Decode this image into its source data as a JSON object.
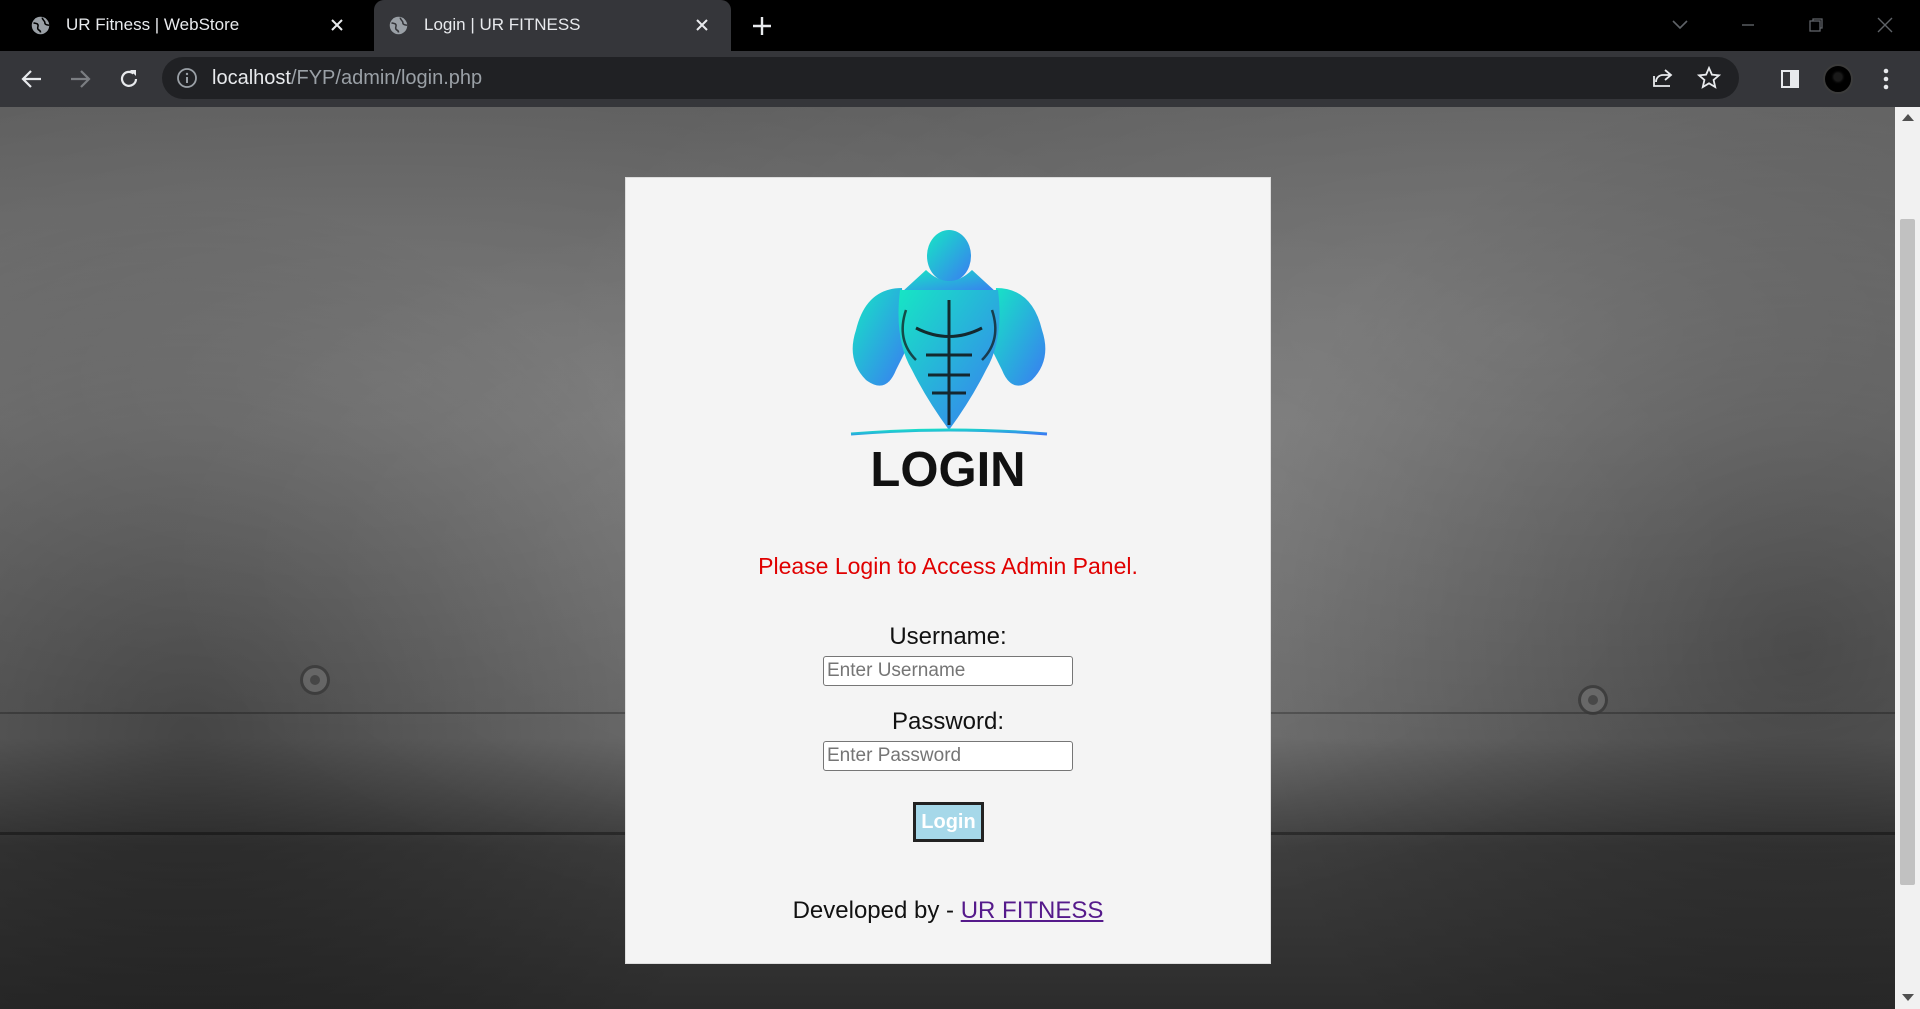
{
  "browser": {
    "tabs": [
      {
        "title": "UR Fitness | WebStore",
        "active": false
      },
      {
        "title": "Login | UR FITNESS",
        "active": true
      }
    ],
    "url": {
      "host": "localhost",
      "path": "/FYP/admin/login.php"
    }
  },
  "login": {
    "heading": "LOGIN",
    "notice": "Please Login to Access Admin Panel.",
    "username_label": "Username:",
    "username_placeholder": "Enter Username",
    "password_label": "Password:",
    "password_placeholder": "Enter Password",
    "submit_label": "Login",
    "credit_prefix": "Developed by -",
    "credit_link": "UR FITNESS"
  },
  "colors": {
    "notice": "#e00000",
    "button": "#a6d8e9",
    "link": "#551a8b",
    "logo_gradient_start": "#16e6c4",
    "logo_gradient_end": "#3a7bf2"
  }
}
